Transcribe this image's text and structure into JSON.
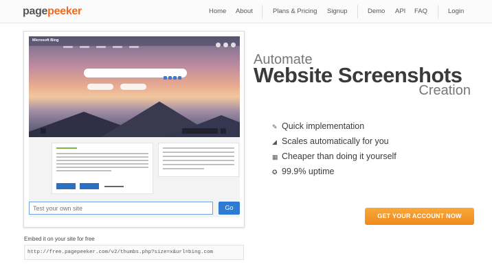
{
  "brand": {
    "part1": "page",
    "part2": "peeker"
  },
  "nav": {
    "home": "Home",
    "about": "About",
    "plans": "Plans & Pricing",
    "signup": "Signup",
    "demo": "Demo",
    "api": "API",
    "faq": "FAQ",
    "login": "Login"
  },
  "preview": {
    "site_logo": "Microsoft Bing",
    "input_placeholder": "Test your own site",
    "go_label": "Go"
  },
  "embed": {
    "label": "Embed it on your site for free",
    "code": "http://free.pagepeeker.com/v2/thumbs.php?size=x&url=bing.com"
  },
  "hero": {
    "line1": "Automate",
    "line2": "Website Screenshots",
    "line3": "Creation"
  },
  "features": [
    {
      "icon": "pencil-icon",
      "glyph": "✎",
      "label": "Quick implementation"
    },
    {
      "icon": "scale-icon",
      "glyph": "◢",
      "label": "Scales automatically for you"
    },
    {
      "icon": "grid-icon",
      "glyph": "▦",
      "label": "Cheaper than doing it yourself"
    },
    {
      "icon": "uptime-icon",
      "glyph": "✪",
      "label": "99.9% uptime"
    }
  ],
  "cta": {
    "label": "GET YOUR ACCOUNT NOW"
  },
  "colors": {
    "brand_orange": "#f06a1f",
    "cta_orange": "#f39a2a",
    "go_blue": "#2f7bd3"
  }
}
